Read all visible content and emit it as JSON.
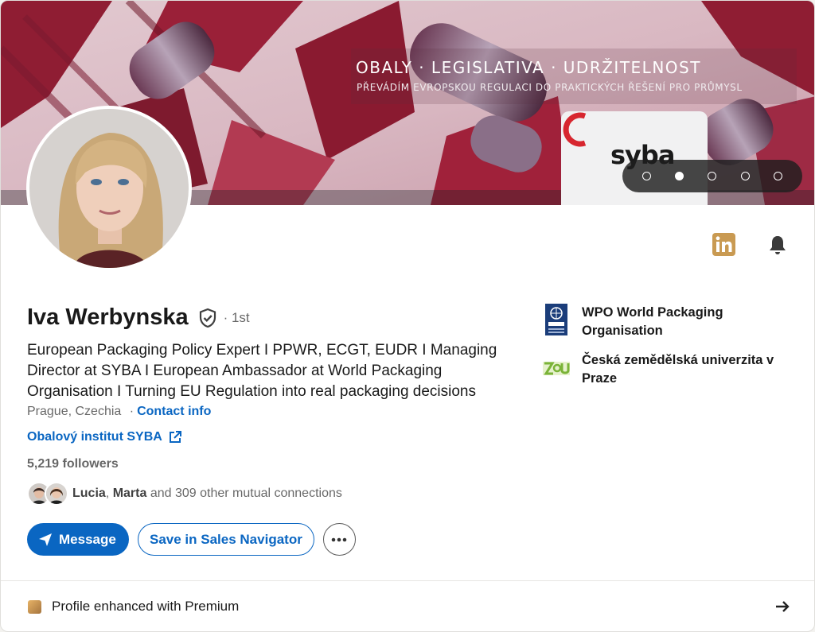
{
  "banner": {
    "title": "OBALY · LEGISLATIVA · UDRŽITELNOST",
    "subtitle": "PŘEVÁDÍM EVROPSKOU REGULACI DO PRAKTICKÝCH ŘEŠENÍ PRO PRŮMYSL",
    "logo_text": "syba",
    "carousel_dots": 5,
    "carousel_active_index": 1
  },
  "profile": {
    "name": "Iva Werbynska",
    "degree": "· 1st",
    "headline": "European Packaging Policy Expert I PPWR, ECGT, EUDR I Managing Director at SYBA I European Ambassador at World Packaging Organisation I Turning EU Regulation into real packaging decisions",
    "location": "Prague, Czechia",
    "contact_sep": "·",
    "contact_label": "Contact info",
    "website_label": "Obalový institut SYBA",
    "followers": "5,219 followers",
    "mutual": {
      "name1": "Lucia",
      "sep": ", ",
      "name2": "Marta",
      "rest": " and 309 other mutual connections"
    }
  },
  "actions": {
    "message_label": "Message",
    "sales_nav_label": "Save in Sales Navigator",
    "more_icon": "ellipsis-icon"
  },
  "organizations": [
    {
      "name": "WPO World Packaging Organisation",
      "icon": "wpo-logo"
    },
    {
      "name": "Česká zemědělská univerzita v Praze",
      "icon": "czu-logo"
    }
  ],
  "footer": {
    "premium_label": "Profile enhanced with Premium"
  },
  "colors": {
    "accent": "#0a66c2",
    "premium_gold": "#c99a52",
    "syba_red": "#d7262f"
  }
}
